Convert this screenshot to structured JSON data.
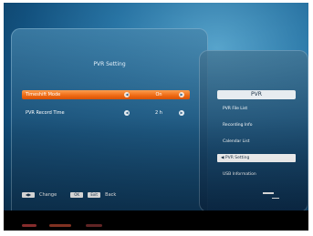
{
  "window": {
    "title": "PVR Setting"
  },
  "settings": [
    {
      "label": "Timeshift Mode",
      "value": "On",
      "selected": true
    },
    {
      "label": "PVR Record Time",
      "value": "2 h",
      "selected": false
    }
  ],
  "help": {
    "change_label": "Change",
    "exit_label": "Back",
    "key_ok": "OK",
    "key_exit": "Exit"
  },
  "side_menu": {
    "header": "PVR",
    "items": [
      {
        "label": "PVR File List"
      },
      {
        "label": "Recording Info"
      },
      {
        "label": "Calendar List"
      },
      {
        "label": "PVR Setting",
        "active": true
      },
      {
        "label": "USB Information"
      }
    ]
  },
  "colors": {
    "selected_row": "#f06a12",
    "screen_bg": "#135483",
    "panel_bg": "#1a4e74",
    "highlight": "#ffffff"
  },
  "icons": {
    "left_arrow": "left-arrow-icon",
    "right_arrow": "right-arrow-icon",
    "cursor": "selection-cursor-icon"
  }
}
